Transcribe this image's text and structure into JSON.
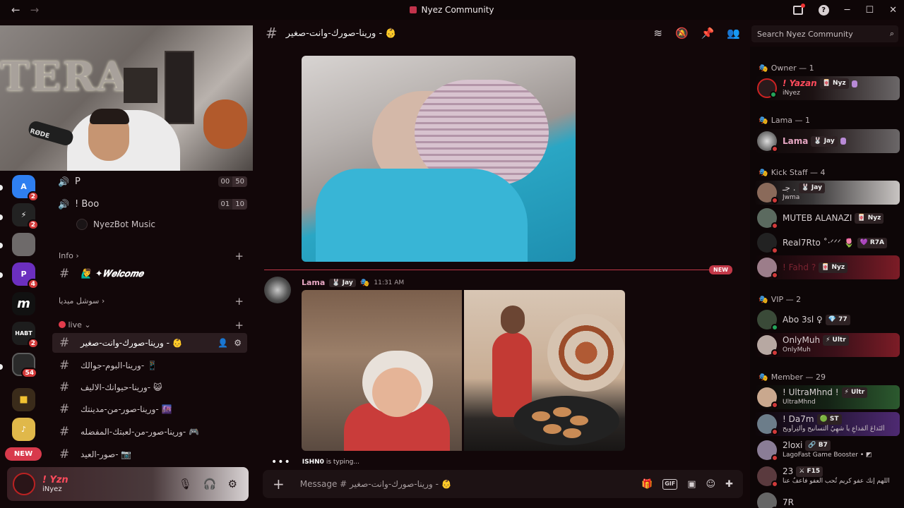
{
  "window": {
    "title": "Nyez Community",
    "nav_back": "←",
    "nav_forward": "→",
    "help": "?",
    "minimize": "─",
    "maximize": "☐",
    "close": "✕"
  },
  "webcam": {
    "wall_text": "TERA",
    "mic_brand": "RØDE"
  },
  "servers": [
    {
      "label": "A",
      "badge": "2",
      "color": "#2f7ff0"
    },
    {
      "label": "⚡",
      "badge": "2",
      "color": "#222222"
    },
    {
      "label": "",
      "badge": "",
      "color": "#6e6a6a"
    },
    {
      "label": "P",
      "badge": "4",
      "color": "#6b2fbf"
    },
    {
      "label": "m",
      "badge": "",
      "color": "#111111"
    },
    {
      "label": "HABT",
      "badge": "2",
      "color": "#1d1d1d"
    },
    {
      "label": "",
      "badge": "54",
      "color": "#2a2a2a"
    },
    {
      "label": "■",
      "badge": "",
      "color": "#d8a520"
    },
    {
      "label": "♪",
      "badge": "",
      "color": "#e0b84a"
    }
  ],
  "new_pill": "NEW",
  "sidebar": {
    "voice": [
      {
        "name": "P",
        "count_a": "00",
        "count_b": "50"
      },
      {
        "name": "! Boo",
        "count_a": "01",
        "count_b": "10"
      }
    ],
    "bot": "NyezBot Music",
    "categories": {
      "info": "Info",
      "social": "سوشل ميديا",
      "live": "live"
    },
    "arrow": "›",
    "chevron": "⌄",
    "welcome": "🙋‍♂️ ✦𝑾𝒆𝒍𝒄𝒐𝒎𝒆",
    "channels": [
      "ورينا-صورك-وانت-صغير - 👶",
      "ورينا-البوم-جوالك- 📱",
      "ورينا-حيوانك-الاليف- 😺",
      "ورينا-صور-من-مدينتك- 🌆",
      "ورينا-صور-من-لعبتك-المفضله- 🎮",
      "صور-العيد- 📷"
    ]
  },
  "user": {
    "name": "! Yzn",
    "status": "iNyez"
  },
  "chat": {
    "channel": "ورينا-صورك-وانت-صغير - 👶",
    "new_tag": "NEW",
    "message": {
      "author": "Lama",
      "tag": "🐰 Jay",
      "time": "11:31 AM"
    },
    "typing_user": "ISHN0",
    "typing_rest": " is typing...",
    "composer_placeholder": "Message # ورينا-صورك-وانت-صغير - 👶",
    "gif": "GIF"
  },
  "search": {
    "placeholder": "Search Nyez Community"
  },
  "members": {
    "roles": [
      {
        "name": "Owner — 1"
      },
      {
        "name": "Lama — 1"
      },
      {
        "name": "Kick Staff — 4"
      },
      {
        "name": "VIP — 2"
      },
      {
        "name": "Member — 29"
      }
    ],
    "list": [
      {
        "name": "! Yazan",
        "tag": "🀄 Nyz",
        "sub": "iNyez"
      },
      {
        "name": "Lama",
        "tag": "🐰 Jay",
        "sub": ""
      },
      {
        "name": "جـ .",
        "tag": "🐰 Jay",
        "sub": "Jwma"
      },
      {
        "name": "MUTEB ALANAZI",
        "tag": "🀄 Nyz",
        "sub": ""
      },
      {
        "name": "Real7Rto ˚·ᐟᐟᐟ 🌷",
        "tag": "💜 R7A",
        "sub": ""
      },
      {
        "name": "! Fahd ?",
        "tag": "🀄 Nyz",
        "sub": ""
      },
      {
        "name": "Abo 3sl ♀",
        "tag": "💎 77",
        "sub": ""
      },
      {
        "name": "OnlyMuh",
        "tag": "⚡ Ultr",
        "sub": "OnlyMuh"
      },
      {
        "name": "! UltraMhnd !",
        "tag": "⚡ Ultr",
        "sub": "UltraMhnd"
      },
      {
        "name": "! Da7m",
        "tag": "🟢 ST",
        "sub": "أَلتَداعَ ألمَداعِ يآ شهِيُ ألتسأنيح وألتِرأويح"
      },
      {
        "name": "2loxi",
        "tag": "🔗 B7",
        "sub": "LagoFast Game Booster • ◩"
      },
      {
        "name": "23",
        "tag": "⚔ F15",
        "sub": "اللهم إنك عفو كريم تُحب العفو فاعفُ عنا"
      },
      {
        "name": "7R",
        "tag": "",
        "sub": ""
      }
    ]
  }
}
